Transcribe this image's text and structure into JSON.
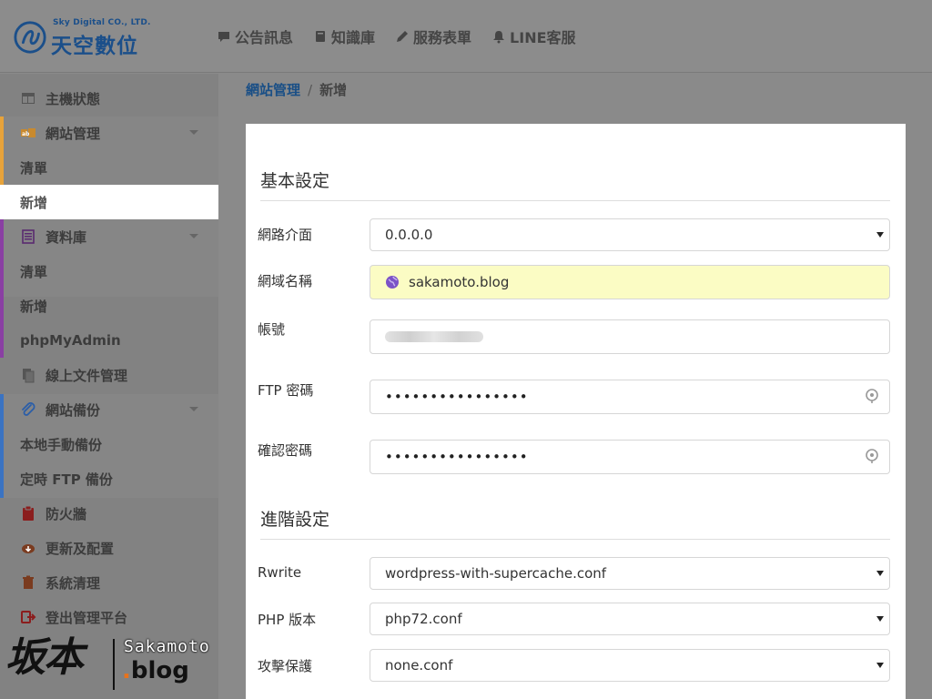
{
  "header": {
    "logo_sub": "Sky Digital CO., LTD.",
    "logo_title": "天空數位",
    "nav": [
      {
        "label": "公告訊息",
        "icon": "comment-icon"
      },
      {
        "label": "知識庫",
        "icon": "book-icon"
      },
      {
        "label": "服務表單",
        "icon": "pencil-icon"
      },
      {
        "label": "LINE客服",
        "icon": "bell-icon"
      }
    ]
  },
  "sidebar": {
    "items": [
      {
        "label": "主機狀態",
        "icon": "dashboard-icon"
      },
      {
        "label": "網站管理",
        "icon": "sitemap-icon"
      },
      {
        "label": "清單"
      },
      {
        "label": "新增"
      },
      {
        "label": "資料庫",
        "icon": "database-icon"
      },
      {
        "label": "清單"
      },
      {
        "label": "新增"
      },
      {
        "label": "phpMyAdmin"
      },
      {
        "label": "線上文件管理",
        "icon": "files-icon"
      },
      {
        "label": "網站備份",
        "icon": "paperclip-icon"
      },
      {
        "label": "本地手動備份"
      },
      {
        "label": "定時 FTP 備份"
      },
      {
        "label": "防火牆",
        "icon": "clipboard-icon"
      },
      {
        "label": "更新及配置",
        "icon": "cloud-download-icon"
      },
      {
        "label": "系統清理",
        "icon": "trash-icon"
      },
      {
        "label": "登出管理平台",
        "icon": "sign-out-icon"
      }
    ],
    "colors": {
      "site_mgmt": "#e8a33a",
      "database": "#8a3fa3",
      "backup": "#3a73c2"
    }
  },
  "breadcrumb": {
    "parent": "網站管理",
    "current": "新增"
  },
  "form": {
    "basic_title": "基本設定",
    "advanced_title": "進階設定",
    "network_label": "網路介面",
    "network_value": "0.0.0.0",
    "domain_label": "網域名稱",
    "domain_value": "sakamoto.blog",
    "account_label": "帳號",
    "ftp_label": "FTP 密碼",
    "ftp_value": "••••••••••••••••",
    "confirm_label": "確認密碼",
    "confirm_value": "••••••••••••••••",
    "rewrite_label": "Rwrite",
    "rewrite_value": "wordpress-with-supercache.conf",
    "php_label": "PHP 版本",
    "php_value": "php72.conf",
    "attack_label": "攻擊保護",
    "attack_value": "none.conf"
  },
  "watermark": {
    "cn": "坂本",
    "en": "Sakamoto",
    "dot": ".",
    "blog": "blog"
  }
}
